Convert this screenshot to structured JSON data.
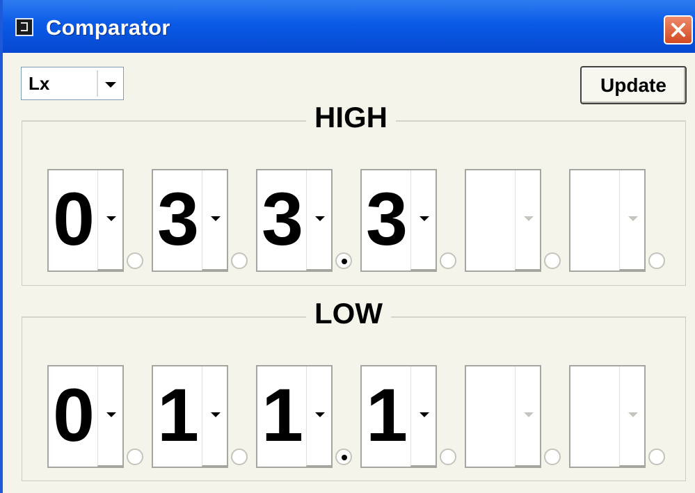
{
  "window": {
    "title": "Comparator",
    "close_icon": "close-icon",
    "app_icon": "app-icon"
  },
  "unit_select": {
    "value": "Lx"
  },
  "toolbar": {
    "update_label": "Update"
  },
  "high": {
    "label": "HIGH",
    "digits": [
      "0",
      "3",
      "3",
      "3",
      "",
      ""
    ],
    "enabled": [
      true,
      true,
      true,
      true,
      false,
      false
    ],
    "selected_radio": 2
  },
  "low": {
    "label": "LOW",
    "digits": [
      "0",
      "1",
      "1",
      "1",
      "",
      ""
    ],
    "enabled": [
      true,
      true,
      true,
      true,
      false,
      false
    ],
    "selected_radio": 2
  }
}
